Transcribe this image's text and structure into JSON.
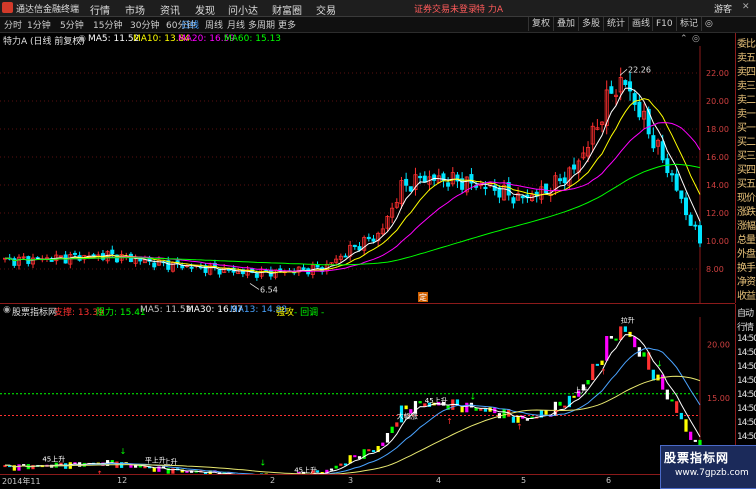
{
  "titlebar": {
    "app_name": "通达信金融终端",
    "menus": [
      "行情",
      "市场",
      "资讯",
      "发现",
      "问小达",
      "财富圈",
      "交易"
    ],
    "notice": "证券交易未登录",
    "stock": "特 力A",
    "guest": "游客"
  },
  "toolbar": {
    "periods": [
      "分时",
      "1分钟",
      "5分钟",
      "15分钟",
      "30分钟",
      "60分钟",
      "日线",
      "周线",
      "月线",
      "多周期",
      "更多"
    ],
    "active_period": "日线",
    "buttons": [
      "复权",
      "叠加",
      "多股",
      "统计",
      "画线",
      "F10",
      "标记",
      "◎"
    ]
  },
  "main_chart": {
    "title": "特力A (日线 前复权)",
    "indicators": [
      {
        "label": "MA5: 11.52",
        "color": "#ffffff"
      },
      {
        "label": "MA10: 13.84",
        "color": "#ffff00"
      },
      {
        "label": "MA20: 16.59",
        "color": "#ff00ff"
      },
      {
        "label": "MA60: 15.13",
        "color": "#00ff00"
      }
    ],
    "price_ticks": [
      "22.00",
      "20.00",
      "18.00",
      "16.00",
      "14.00",
      "12.00",
      "10.00",
      "8.00"
    ],
    "high_label": "22.26",
    "low_label": "6.54",
    "marker": "定"
  },
  "side_panel": {
    "items": [
      "委比",
      "卖五",
      "卖四",
      "卖三",
      "卖二",
      "卖一",
      "买一",
      "买二",
      "买三",
      "买四",
      "买五",
      "现价",
      "涨跌",
      "涨幅",
      "总量",
      "外盘",
      "换手",
      "净资",
      "收益"
    ],
    "badge": "特力A"
  },
  "sub_chart": {
    "title": "股票指标网",
    "indicators": [
      {
        "label": "支撑: 13.39",
        "color": "#ff3030"
      },
      {
        "label": "阻力: 15.41",
        "color": "#00ff00"
      },
      {
        "label": "MA5: 11.52",
        "color": "#c8c8c8"
      },
      {
        "label": "MA30: 16.97",
        "color": "#ffffff"
      },
      {
        "label": "MA13: 14.88",
        "color": "#4aa3ff"
      },
      {
        "label": "强攻",
        "color": "#ffff00"
      },
      {
        "label": "- 回调 -",
        "color": "#00ff00"
      }
    ],
    "price_ticks": [
      "20.00",
      "15.00",
      "10.00"
    ],
    "side_items": [
      "自动",
      "行情",
      "14:50",
      "14:50",
      "14:50",
      "14:50",
      "14:50",
      "14:50",
      "14:50",
      "14:50",
      "14:50",
      "14:50"
    ],
    "annotations": [
      "45上升",
      "平上升",
      "上升",
      "45上升",
      "大幅涨",
      "45上升",
      "上升",
      "拉升"
    ]
  },
  "x_axis": {
    "labels": [
      "2014年11",
      "12",
      "2",
      "3",
      "4",
      "5",
      "6"
    ]
  },
  "watermark": {
    "title": "股票指标网",
    "url": "www.7gpzb.com"
  },
  "colors": {
    "up": "#ff3030",
    "down": "#00e5ff",
    "ma5": "#ffffff",
    "ma10": "#ffff00",
    "ma20": "#ff00ff",
    "ma60": "#00ff00",
    "support_line": "#ff3030",
    "resistance_line": "#00ff00"
  }
}
